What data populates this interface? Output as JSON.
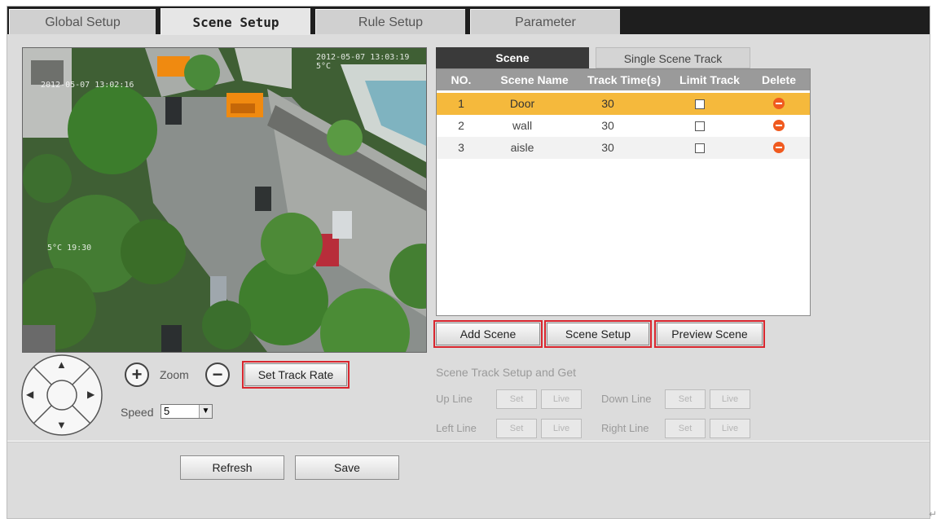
{
  "tabs": [
    {
      "label": "Global Setup",
      "active": false
    },
    {
      "label": "Scene Setup",
      "active": true
    },
    {
      "label": "Rule Setup",
      "active": false
    },
    {
      "label": "Parameter",
      "active": false
    }
  ],
  "video": {
    "osd_time": "2012-05-07 13:03:19 5°C",
    "osd_left": "2012-05-07 13:02:16",
    "osd_mid": "5°C  19:30"
  },
  "ptz": {
    "zoom_label": "Zoom",
    "zoom_in": "+",
    "zoom_out": "−",
    "set_track_rate": "Set Track Rate",
    "speed_label": "Speed",
    "speed_value": "5",
    "up": "▲",
    "down": "▼",
    "left": "◀",
    "right": "▶"
  },
  "scene_tabs": {
    "scene": "Scene",
    "single": "Single Scene Track"
  },
  "table": {
    "headers": [
      "NO.",
      "Scene Name",
      "Track Time(s)",
      "Limit Track",
      "Delete"
    ],
    "rows": [
      {
        "no": "1",
        "name": "Door",
        "time": "30",
        "selected": true
      },
      {
        "no": "2",
        "name": "wall",
        "time": "30",
        "selected": false
      },
      {
        "no": "3",
        "name": "aisle",
        "time": "30",
        "selected": false
      }
    ]
  },
  "scene_buttons": {
    "add": "Add Scene",
    "setup": "Scene Setup",
    "preview": "Preview Scene"
  },
  "track_setup": {
    "title": "Scene Track Setup and Get",
    "up_line": "Up Line",
    "down_line": "Down Line",
    "left_line": "Left Line",
    "right_line": "Right Line",
    "set": "Set",
    "live": "Live"
  },
  "footer": {
    "refresh": "Refresh",
    "save": "Save"
  },
  "colors": {
    "selected_row": "#f5b93c",
    "highlight": "#d9262e",
    "header": "#9a9a9a"
  }
}
